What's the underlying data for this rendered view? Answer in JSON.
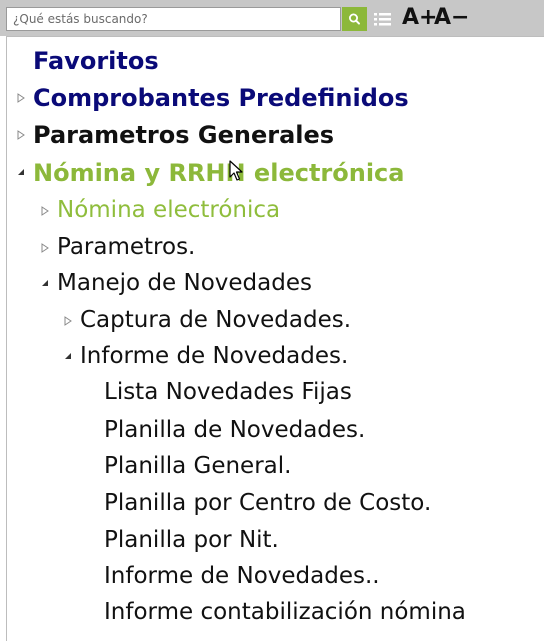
{
  "search": {
    "placeholder": "¿Qué estás buscando?"
  },
  "toolbar": {
    "font_increase_label": "A+",
    "font_decrease_label": "A−"
  },
  "colors": {
    "navy": "#0a0a78",
    "green": "#8cb83a",
    "toolbar_bg": "#c7c7c7"
  },
  "icons": {
    "search": "search-icon",
    "list": "list-icon",
    "cursor": "mouse-pointer-icon"
  },
  "tree": {
    "favoritos": "Favoritos",
    "comprobantes": "Comprobantes Predefinidos",
    "parametros_generales": "Parametros Generales",
    "nomina_rrhh": "Nómina y RRHH electrónica",
    "nomina_electronica": "Nómina electrónica",
    "parametros": "Parametros.",
    "manejo_novedades": "Manejo de Novedades",
    "captura_novedades": "Captura de Novedades.",
    "informe_novedades": "Informe de Novedades.",
    "lista_novedades_fijas": "Lista Novedades Fijas",
    "planilla_novedades": "Planilla de Novedades.",
    "planilla_general": "Planilla General.",
    "planilla_centro_costo": "Planilla por Centro de Costo.",
    "planilla_nit": "Planilla por Nit.",
    "informe_novedades_2": "Informe de Novedades..",
    "informe_contabilizacion": "Informe contabilización nómina"
  }
}
